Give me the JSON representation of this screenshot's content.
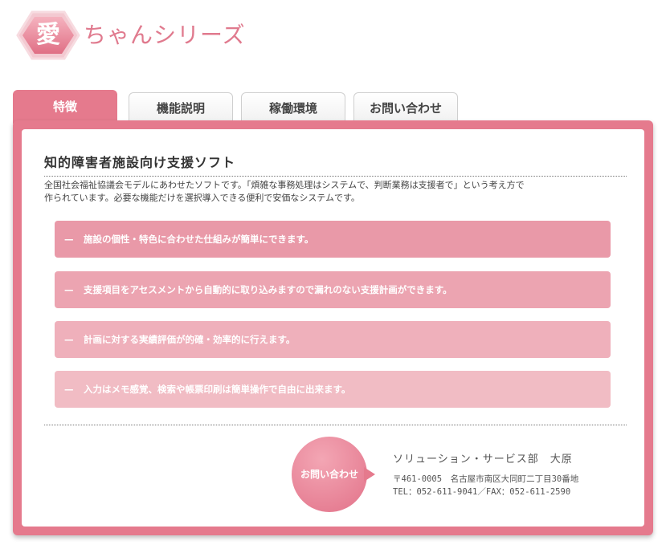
{
  "logo": {
    "kanji": "愛",
    "title": "ちゃんシリーズ"
  },
  "tabs": [
    {
      "label": "特徴",
      "active": true
    },
    {
      "label": "機能説明",
      "active": false
    },
    {
      "label": "稼働環境",
      "active": false
    },
    {
      "label": "お問い合わせ",
      "active": false
    }
  ],
  "main": {
    "heading": "知的障害者施設向け支援ソフト",
    "description_line1": "全国社会福祉協議会モデルにあわせたソフトです。「煩雑な事務処理はシステムで、判断業務は支援者で」という考え方で",
    "description_line2": "作られています。必要な機能だけを選択導入できる便利で安価なシステムです。",
    "features": [
      {
        "dash": "—",
        "text": "施設の個性・特色に合わせた仕組みが簡単にできます。",
        "color": "#e999a8"
      },
      {
        "dash": "—",
        "text": "支援項目をアセスメントから自動的に取り込みますので漏れのない支援計画ができます。",
        "color": "#eca4b1"
      },
      {
        "dash": "—",
        "text": "計画に対する実績評価が的確・効率的に行えます。",
        "color": "#efb0bb"
      },
      {
        "dash": "—",
        "text": "入力はメモ感覚、検索や帳票印刷は簡単操作で自由に出来ます。",
        "color": "#f1bcc4"
      }
    ]
  },
  "contact": {
    "button_label": "お問い合わせ",
    "department": "ソリューション・サービス部　大原",
    "address": "〒461-0005　名古屋市南区大同町二丁目30番地",
    "phone": "TEL：052-611-9041／FAX：052-611-2590"
  },
  "colors": {
    "accent": "#e57a8d",
    "logo_text": "#e07a8e"
  }
}
